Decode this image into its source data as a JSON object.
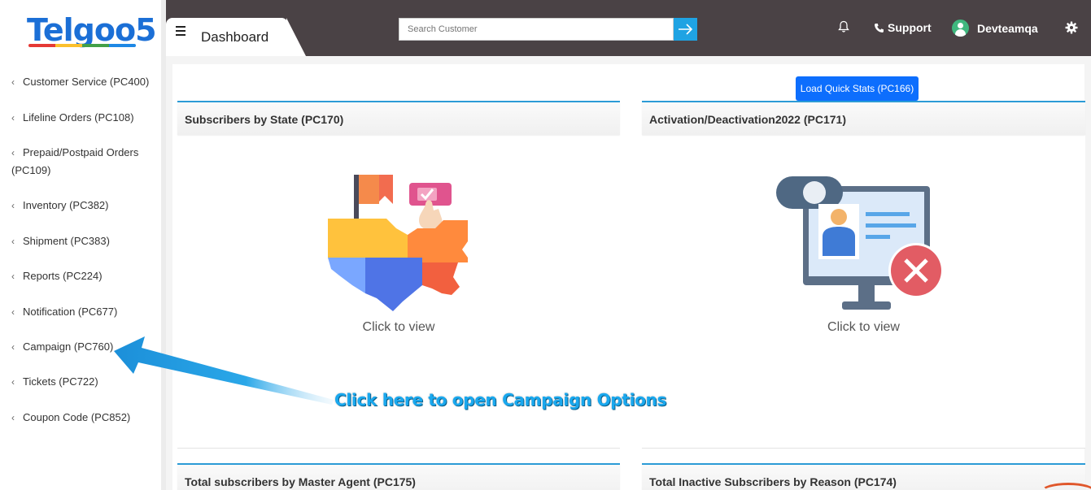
{
  "sidebar": {
    "logo": "Telgoo5",
    "items": [
      {
        "label": "Customer Service (PC400)"
      },
      {
        "label": "Lifeline Orders (PC108)"
      },
      {
        "label": "Prepaid/Postpaid Orders (PC109)"
      },
      {
        "label": "Inventory (PC382)"
      },
      {
        "label": "Shipment (PC383)"
      },
      {
        "label": "Reports (PC224)"
      },
      {
        "label": "Notification (PC677)"
      },
      {
        "label": "Campaign (PC760)"
      },
      {
        "label": "Tickets (PC722)"
      },
      {
        "label": "Coupon Code (PC852)"
      }
    ]
  },
  "header": {
    "page_title": "Dashboard",
    "search_placeholder": "Search Customer",
    "support_label": "Support",
    "username": "Devteamqa"
  },
  "main": {
    "quick_stats_button": "Load Quick Stats (PC166)",
    "cards": [
      {
        "title": "Subscribers by State (PC170)",
        "cta": "Click to view"
      },
      {
        "title": "Activation/Deactivation2022 (PC171)",
        "cta": "Click to view"
      },
      {
        "title": "Total subscribers by Master Agent (PC175)"
      },
      {
        "title": "Total Inactive Subscribers by Reason (PC174)"
      }
    ]
  },
  "annotation": {
    "text": "Click here to open Campaign Options"
  },
  "colors": {
    "header_bg": "#4a4245",
    "accent": "#1fa3e3",
    "button_blue": "#0d6efd",
    "annotation_blue": "#1aa8ee"
  },
  "icons": [
    "hamburger-icon",
    "arrow-right-icon",
    "bell-icon",
    "phone-icon",
    "user-avatar-icon",
    "gear-icon",
    "chevron-left-icon"
  ]
}
